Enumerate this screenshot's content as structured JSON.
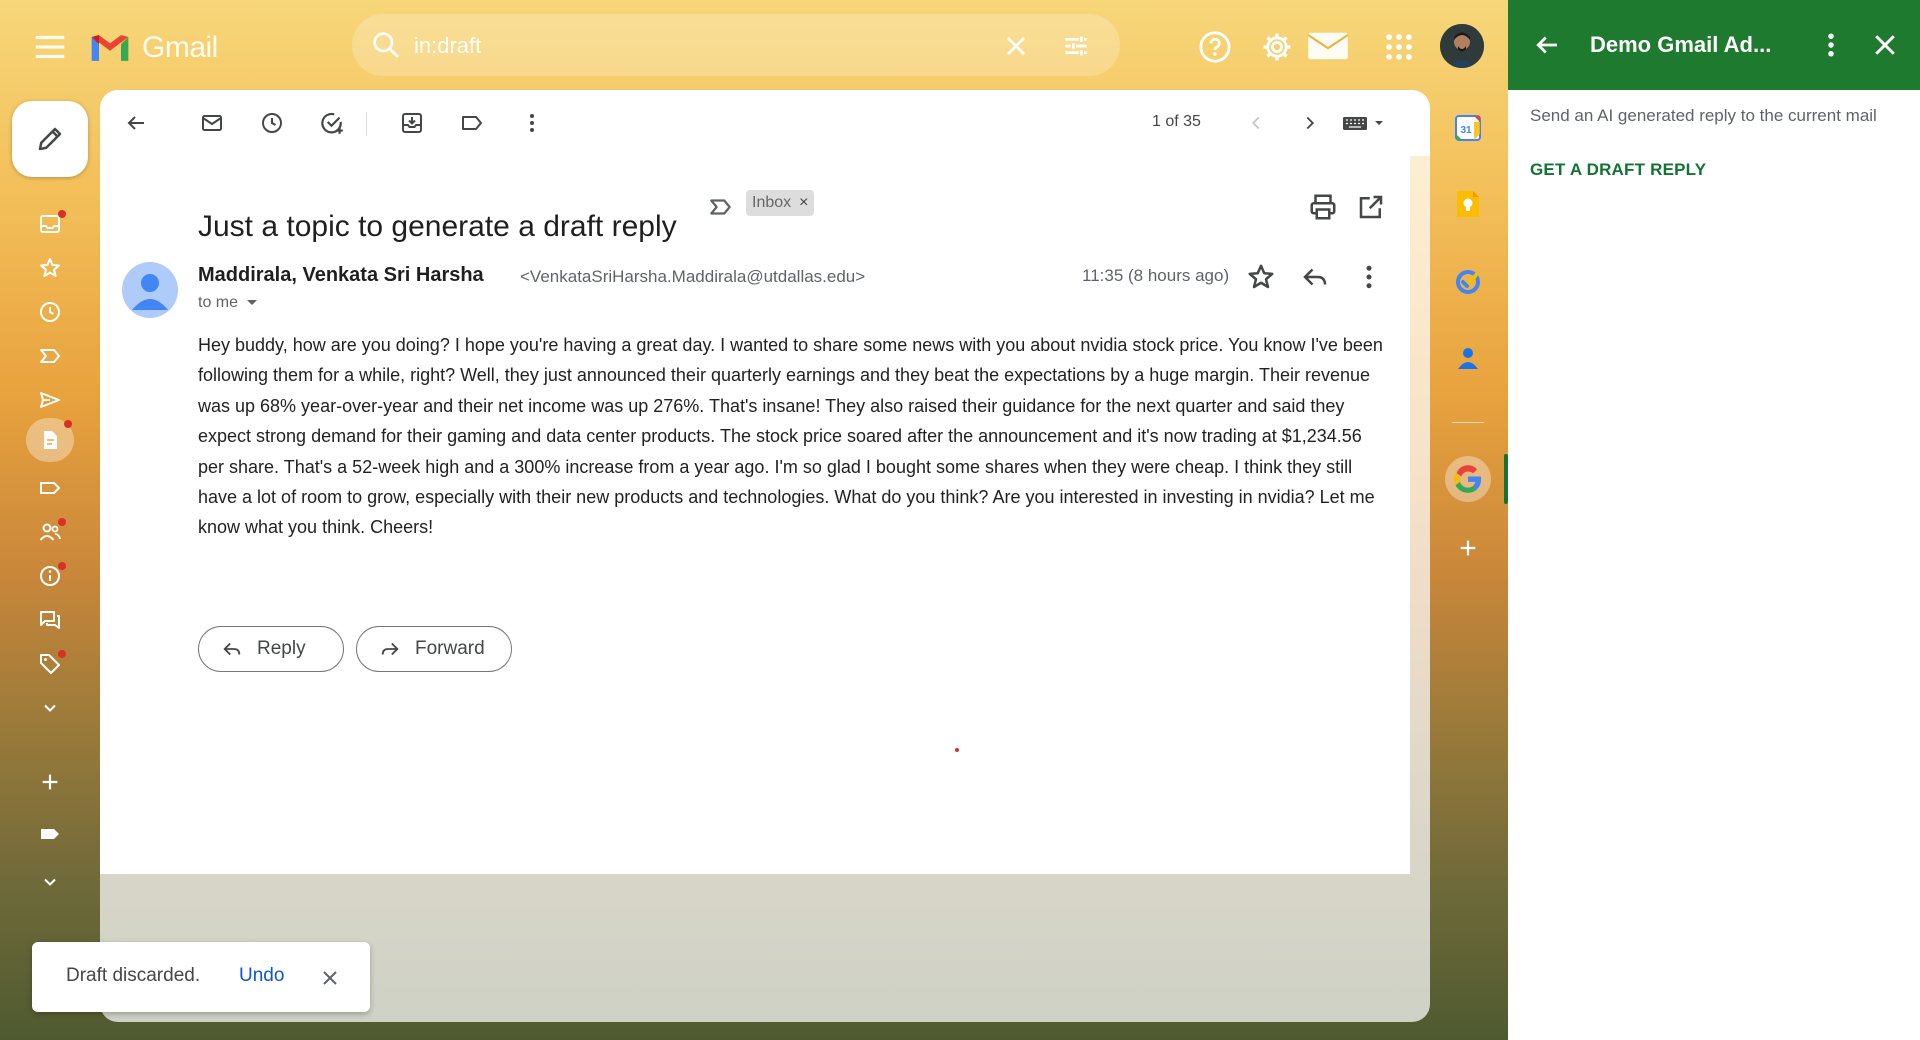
{
  "app": {
    "name": "Gmail"
  },
  "search": {
    "value": "in:draft"
  },
  "toolbar": {
    "pager": "1 of 35"
  },
  "message": {
    "subject": "Just a topic to generate a draft reply",
    "label_chip": "Inbox",
    "label_chip_remove": "×",
    "sender_name": "Maddirala, Venkata Sri Harsha",
    "sender_email": "<VenkataSriHarsha.Maddirala@utdallas.edu>",
    "recipient": "to me",
    "time": "11:35 (8 hours ago)",
    "body": "Hey buddy, how are you doing? I hope you're having a great day. I wanted to share some news with you about nvidia stock price. You know I've been following them for a while, right? Well, they just announced their quarterly earnings and they beat the expectations by a huge margin. Their revenue was up 68% year-over-year and their net income was up 276%. That's insane! They also raised their guidance for the next quarter and said they expect strong demand for their gaming and data center products. The stock price soared after the announcement and it's now trading at $1,234.56 per share. That's a 52-week high and a 300% increase from a year ago. I'm so glad I bought some shares when they were cheap. I think they still have a lot of room to grow, especially with their new products and technologies. What do you think? Are you interested in investing in nvidia? Let me know what you think. Cheers!",
    "reply_label": "Reply",
    "forward_label": "Forward"
  },
  "right_rail": {
    "calendar_day": "31"
  },
  "addon": {
    "title": "Demo Gmail Ad...",
    "description": "Send an AI generated reply to the current mail",
    "action_label": "GET A DRAFT REPLY"
  },
  "toast": {
    "message": "Draft discarded.",
    "undo_label": "Undo"
  },
  "colors": {
    "addon_header": "#1e7a2e",
    "addon_action": "#137333",
    "link_blue": "#0b57d0",
    "unread_dot": "#d93025"
  },
  "icons": {
    "left_rail": [
      "compose-icon",
      "inbox-icon",
      "star-icon",
      "clock-icon",
      "important-icon",
      "send-icon",
      "draft-icon",
      "label-icon",
      "contacts-icon",
      "info-icon",
      "forum-icon",
      "tag-icon",
      "expand-icon",
      "add-label-icon",
      "label-filled-icon",
      "expand-more-icon"
    ],
    "right_rail": [
      "calendar-icon",
      "keep-icon",
      "tasks-icon",
      "contacts-icon",
      "google-addon-icon",
      "add-icon"
    ]
  }
}
